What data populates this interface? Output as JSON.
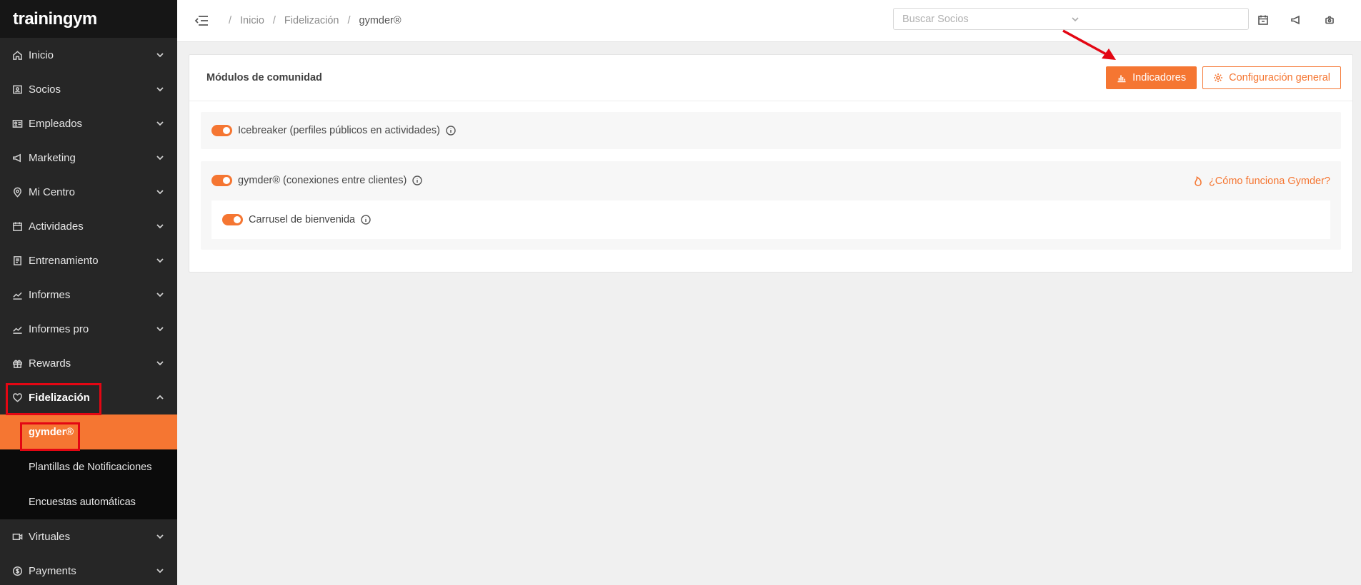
{
  "app": {
    "logo": "trainingym"
  },
  "sidebar": {
    "items": [
      {
        "label": "Inicio",
        "icon": "home-icon"
      },
      {
        "label": "Socios",
        "icon": "id-card-icon"
      },
      {
        "label": "Empleados",
        "icon": "badge-icon"
      },
      {
        "label": "Marketing",
        "icon": "megaphone-icon"
      },
      {
        "label": "Mi Centro",
        "icon": "location-pin-icon"
      },
      {
        "label": "Actividades",
        "icon": "calendar-icon"
      },
      {
        "label": "Entrenamiento",
        "icon": "clipboard-icon"
      },
      {
        "label": "Informes",
        "icon": "line-chart-icon"
      },
      {
        "label": "Informes pro",
        "icon": "line-chart-icon"
      },
      {
        "label": "Rewards",
        "icon": "gift-icon"
      },
      {
        "label": "Fidelización",
        "icon": "heart-icon"
      }
    ],
    "submenu": [
      {
        "label": "gymder®",
        "active": true
      },
      {
        "label": "Plantillas de Notificaciones"
      },
      {
        "label": "Encuestas automáticas"
      }
    ],
    "bottom_items": [
      {
        "label": "Virtuales",
        "icon": "video-icon"
      },
      {
        "label": "Payments",
        "icon": "dollar-circle-icon"
      }
    ]
  },
  "topbar": {
    "breadcrumb": [
      "Inicio",
      "Fidelización",
      "gymder®"
    ],
    "search_placeholder": "Buscar Socios"
  },
  "main": {
    "title": "Módulos de comunidad",
    "indicators_button": "Indicadores",
    "config_button": "Configuración general",
    "modules": {
      "icebreaker": "Icebreaker (perfiles públicos en actividades)",
      "gymder": "gymder® (conexiones entre clientes)",
      "gymder_help": "¿Cómo funciona Gymder?",
      "carousel": "Carrusel de bienvenida"
    }
  },
  "colors": {
    "accent": "#f57632",
    "sidebar": "#262626",
    "highlight": "#e30613"
  }
}
